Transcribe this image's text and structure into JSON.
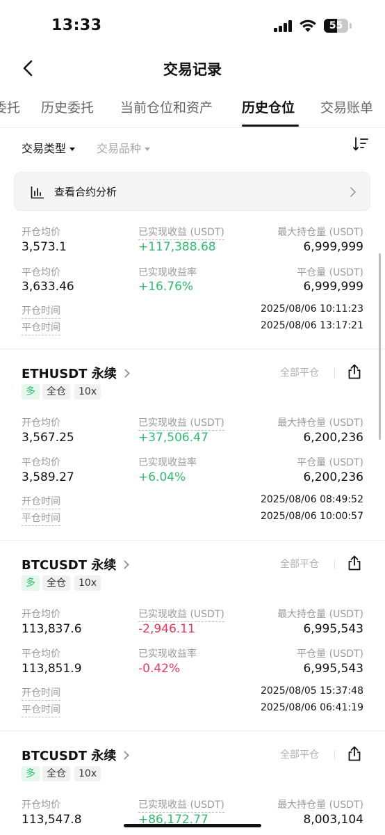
{
  "status_bar": {
    "time": "13:33",
    "battery": "55",
    "battery_level": 0.55
  },
  "header": {
    "title": "交易记录"
  },
  "tabs": [
    {
      "label": "委托"
    },
    {
      "label": "历史委托"
    },
    {
      "label": "当前仓位和资产"
    },
    {
      "label": "历史仓位"
    },
    {
      "label": "交易账单"
    }
  ],
  "filters": {
    "type": "交易类型",
    "symbol": "交易品种"
  },
  "analysis": {
    "label": "查看合约分析"
  },
  "labels": {
    "open_avg": "开仓均价",
    "realized_pnl": "已实现收益 (USDT)",
    "max_pos": "最大持仓量 (USDT)",
    "close_avg": "平仓均价",
    "pnl_rate": "已实现收益率",
    "close_qty": "平仓量 (USDT)",
    "open_time": "开仓时间",
    "close_time": "平仓时间",
    "close_all": "全部平仓"
  },
  "records": [
    {
      "open_avg": "3,573.1",
      "realized_pnl": "+117,388.68",
      "max_pos": "6,999,999",
      "close_avg": "3,633.46",
      "pnl_rate": "+16.76%",
      "close_qty": "6,999,999",
      "open_time": "2025/08/06 10:11:23",
      "close_time": "2025/08/06 13:17:21"
    },
    {
      "symbol": "ETHUSDT 永续",
      "side": "多",
      "margin": "全仓",
      "leverage": "10x",
      "open_avg": "3,567.25",
      "realized_pnl": "+37,506.47",
      "max_pos": "6,200,236",
      "close_avg": "3,589.27",
      "pnl_rate": "+6.04%",
      "close_qty": "6,200,236",
      "open_time": "2025/08/06 08:49:52",
      "close_time": "2025/08/06 10:00:57"
    },
    {
      "symbol": "BTCUSDT 永续",
      "side": "多",
      "margin": "全仓",
      "leverage": "10x",
      "open_avg": "113,837.6",
      "realized_pnl": "-2,946.11",
      "max_pos": "6,995,543",
      "close_avg": "113,851.9",
      "pnl_rate": "-0.42%",
      "close_qty": "6,995,543",
      "open_time": "2025/08/05 15:37:48",
      "close_time": "2025/08/06 06:41:19"
    },
    {
      "symbol": "BTCUSDT 永续",
      "side": "多",
      "margin": "全仓",
      "leverage": "10x",
      "open_avg": "113,547.8",
      "realized_pnl": "+86,172.77",
      "max_pos": "8,003,104"
    }
  ],
  "colors": {
    "positive": "#2ebd6d",
    "negative": "#e5395d",
    "muted": "#9a9a9a"
  }
}
